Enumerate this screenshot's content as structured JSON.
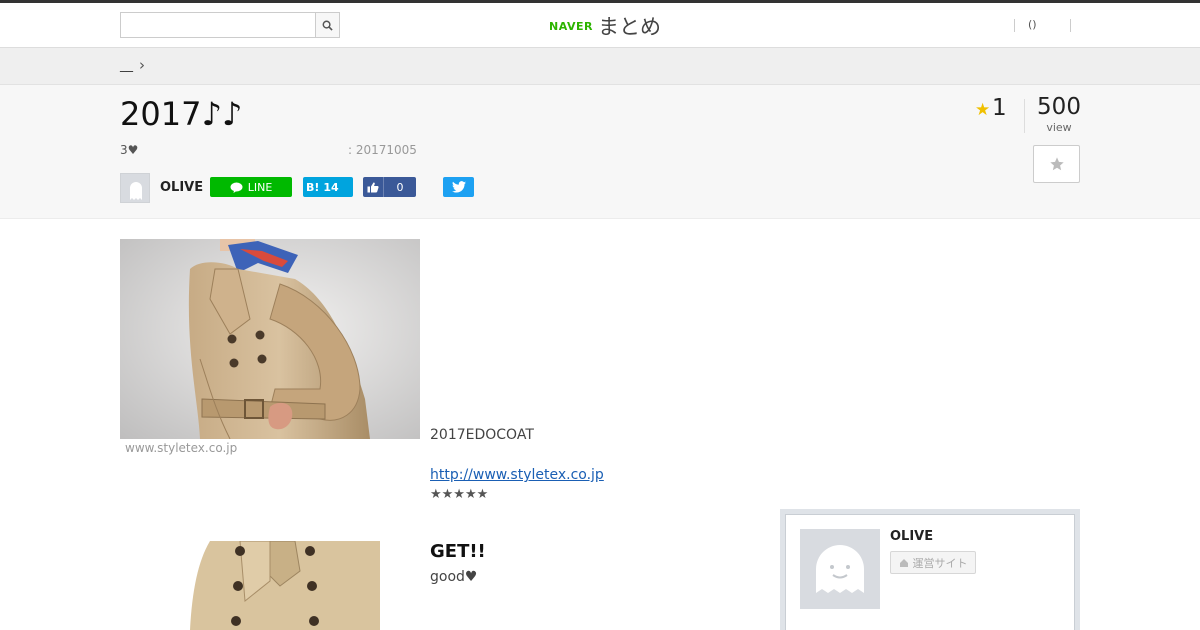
{
  "header": {
    "search_placeholder": "",
    "logo_naver": "NAVER",
    "logo_matome": "まとめ",
    "right_link": "()"
  },
  "breadcrumb": {
    "item": "__"
  },
  "article": {
    "title": "2017♪♪",
    "favorites_text": "3♥",
    "date": ": 20171005",
    "fav_count": "1",
    "view_count": "500",
    "view_label": "view",
    "author": "OLIVE"
  },
  "share": {
    "line_label": "LINE",
    "hatena_label": "B!",
    "hatena_count": "14",
    "fb_count": "0"
  },
  "content": {
    "image1_source": "www.styletex.co.jp",
    "description": "2017EDOCOAT",
    "link_text": "http://www.styletex.co.jp",
    "rating": "★★★★★",
    "heading": "GET!!",
    "body": "good♥"
  },
  "author_card": {
    "name": "OLIVE",
    "site_button": "運営サイト"
  },
  "colors": {
    "line": "#00b900",
    "hatena": "#00a4de",
    "facebook": "#3b5998",
    "twitter": "#1da1f2",
    "naver": "#2db400",
    "star": "#f0c000"
  }
}
